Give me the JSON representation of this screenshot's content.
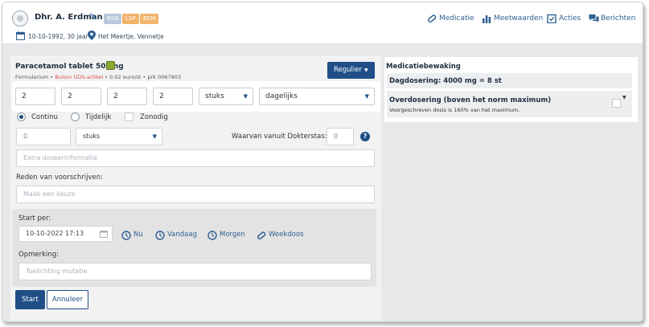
{
  "patient": {
    "name": "Dhr. A. Erdman",
    "badges": [
      "BSN",
      "LSP",
      "BEM"
    ],
    "birth": "10-10-1992, 30 jaar",
    "location": "Het Meertje, Vennetje"
  },
  "nav": {
    "medicatie": "Medicatie",
    "meetwaarden": "Meetwaarden",
    "acties": "Acties",
    "berichten": "Berichten"
  },
  "drug": {
    "name": "Paracetamol tablet 500mg",
    "formularium": "Formularium",
    "gds": "Buiten GDS-artikel",
    "price": "0.02 euro/st",
    "prk": "prk 0067903"
  },
  "regime_button": "Regulier",
  "dosing": {
    "values": [
      "2",
      "2",
      "2",
      "2"
    ],
    "unit": "stuks",
    "frequency": "dagelijks"
  },
  "schedule": {
    "continu": "Continu",
    "tijdelijk": "Tijdelijk",
    "zonodig": "Zonodig"
  },
  "stock": {
    "amount": "0",
    "unit": "stuks",
    "dokterstas_label": "Waarvan vanuit Dokterstas:",
    "dokterstas_value": "0"
  },
  "extra_placeholder": "Extra doseerinformatie",
  "reden": {
    "label": "Reden van voorschrijven:",
    "placeholder": "Maak een keuze"
  },
  "start": {
    "label": "Start per:",
    "datetime": "10-10-2022 17:13",
    "shortcuts": [
      "Nu",
      "Vandaag",
      "Morgen",
      "Weekdoos"
    ]
  },
  "opmerking": {
    "label": "Opmerking:",
    "placeholder": "Toelichting mutatie"
  },
  "buttons": {
    "start": "Start",
    "annuleer": "Annuleer"
  },
  "monitoring": {
    "title": "Medicatiebewaking",
    "daily_dose": "Dagdosering: 4000 mg = 8 st",
    "overdose_title": "Overdosering (boven het norm maximum)",
    "overdose_desc": "Voorgeschreven dosis is 160% van het maximum."
  },
  "colors": {
    "primary": "#1f4f86",
    "link": "#2f5f93",
    "badge_orange": "#f0b46a",
    "badge_blue": "#b8c7dc",
    "warning_red": "#d9534f"
  }
}
